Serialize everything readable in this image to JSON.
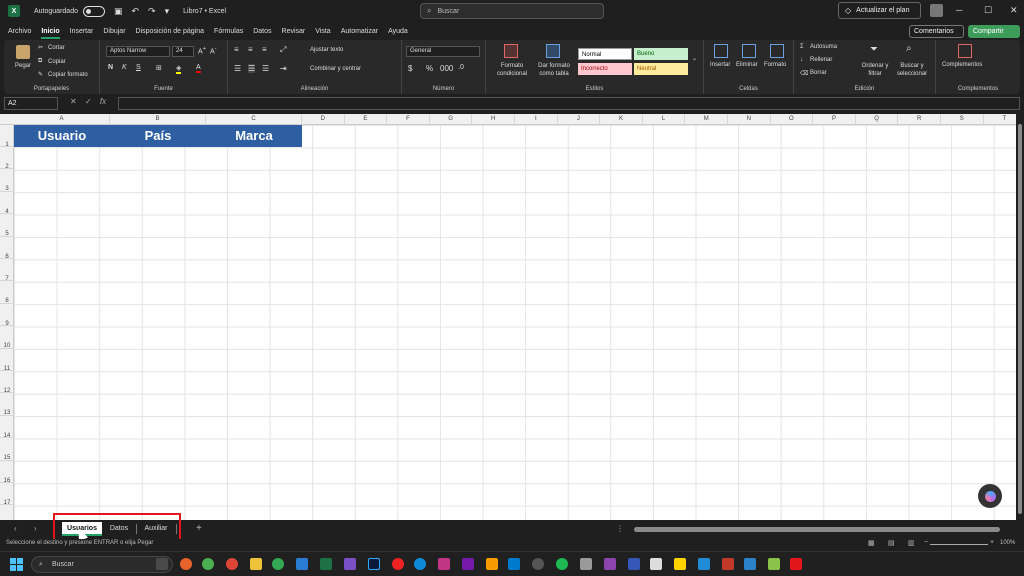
{
  "titlebar": {
    "autosave_label": "Autoguardado",
    "doc_title": "Libro7 • Excel",
    "search_placeholder": "Buscar",
    "upgrade_label": "Actualizar el plan"
  },
  "menu": {
    "tabs": [
      "Archivo",
      "Inicio",
      "Insertar",
      "Dibujar",
      "Disposición de página",
      "Fórmulas",
      "Datos",
      "Revisar",
      "Vista",
      "Automatizar",
      "Ayuda"
    ],
    "active": "Inicio",
    "comments_label": "Comentarios",
    "share_label": "Compartir"
  },
  "ribbon": {
    "clipboard": {
      "paste": "Pegar",
      "cut": "Cortar",
      "copy": "Copiar",
      "format_painter": "Copiar formato",
      "label": "Portapapeles"
    },
    "font": {
      "name": "Aptos Narrow",
      "size": "24",
      "label": "Fuente"
    },
    "alignment": {
      "wrap": "Ajustar texto",
      "merge": "Combinar y centrar",
      "label": "Alineación"
    },
    "number": {
      "format": "General",
      "label": "Número"
    },
    "styles": {
      "conditional": "Formato condicional",
      "as_table": "Dar formato como tabla",
      "normal": "Normal",
      "good": "Bueno",
      "bad": "Incorrecto",
      "neutral": "Neutral",
      "label": "Estilos"
    },
    "cells": {
      "insert": "Insertar",
      "delete": "Eliminar",
      "format": "Formato",
      "label": "Celdas"
    },
    "editing": {
      "autosum": "Autosuma",
      "fill": "Rellenar",
      "clear": "Borrar",
      "sort": "Ordenar y filtrar",
      "find": "Buscar y seleccionar",
      "label": "Edición"
    },
    "addins": {
      "button": "Complementos",
      "label": "Complementos"
    }
  },
  "formula_bar": {
    "name_box": "A2",
    "fx": "fx"
  },
  "grid": {
    "columns": [
      "A",
      "B",
      "C",
      "D",
      "E",
      "F",
      "G",
      "H",
      "I",
      "J",
      "K",
      "L",
      "M",
      "N",
      "O",
      "P",
      "Q",
      "R",
      "S",
      "T"
    ],
    "rows": [
      "1",
      "2",
      "3",
      "4",
      "5",
      "6",
      "7",
      "8",
      "9",
      "10",
      "11",
      "12",
      "13",
      "14",
      "15",
      "16",
      "17"
    ],
    "headers": [
      "Usuario",
      "País",
      "Marca"
    ]
  },
  "sheets": {
    "tabs": [
      "Usuarios",
      "Datos",
      "Auxiliar"
    ],
    "active": "Usuarios"
  },
  "status": {
    "text": "Seleccione el destino y presione ENTRAR o elija Pegar",
    "zoom": "100%"
  },
  "taskbar": {
    "search_label": "Buscar"
  },
  "colors": {
    "header_fill": "#2e5fa3",
    "accent": "#21a366",
    "highlight": "#e0161b"
  }
}
